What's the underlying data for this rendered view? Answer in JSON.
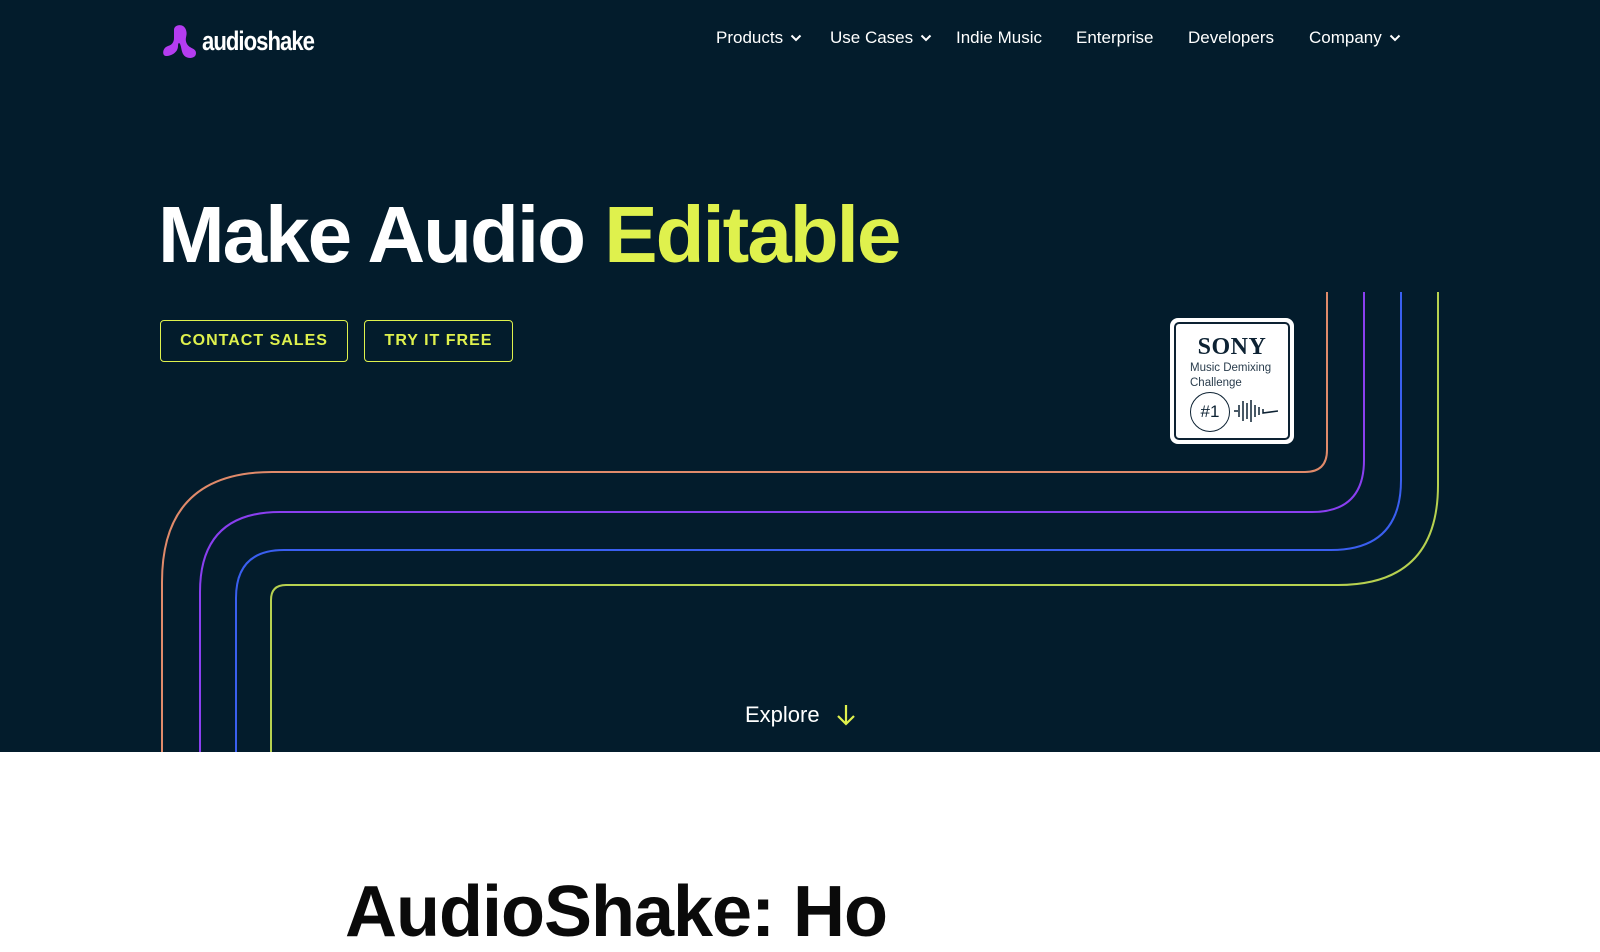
{
  "brand": {
    "name": "audioshake",
    "accent_color": "#dff14d",
    "logo_color": "#b43cf0",
    "background": "#031c2c"
  },
  "nav": {
    "items": [
      {
        "label": "Products",
        "dropdown": true
      },
      {
        "label": "Use Cases",
        "dropdown": true
      },
      {
        "label": "Indie Music",
        "dropdown": false
      },
      {
        "label": "Enterprise",
        "dropdown": false
      },
      {
        "label": "Developers",
        "dropdown": false
      },
      {
        "label": "Company",
        "dropdown": true
      }
    ]
  },
  "hero": {
    "title_prefix": "Make Audio",
    "title_accent": "Editable",
    "buttons": {
      "contact_sales": "CONTACT SALES",
      "try_free": "TRY IT FREE"
    },
    "explore_label": "Explore"
  },
  "badge": {
    "brand": "SONY",
    "line1": "Music Demixing",
    "line2": "Challenge",
    "rank": "#1"
  },
  "decor": {
    "line_colors": [
      "#e08a6a",
      "#8a3ff0",
      "#3a5ff0",
      "#b7d150"
    ]
  },
  "next_section": {
    "heading_partial": "AudioShake: Ho"
  }
}
